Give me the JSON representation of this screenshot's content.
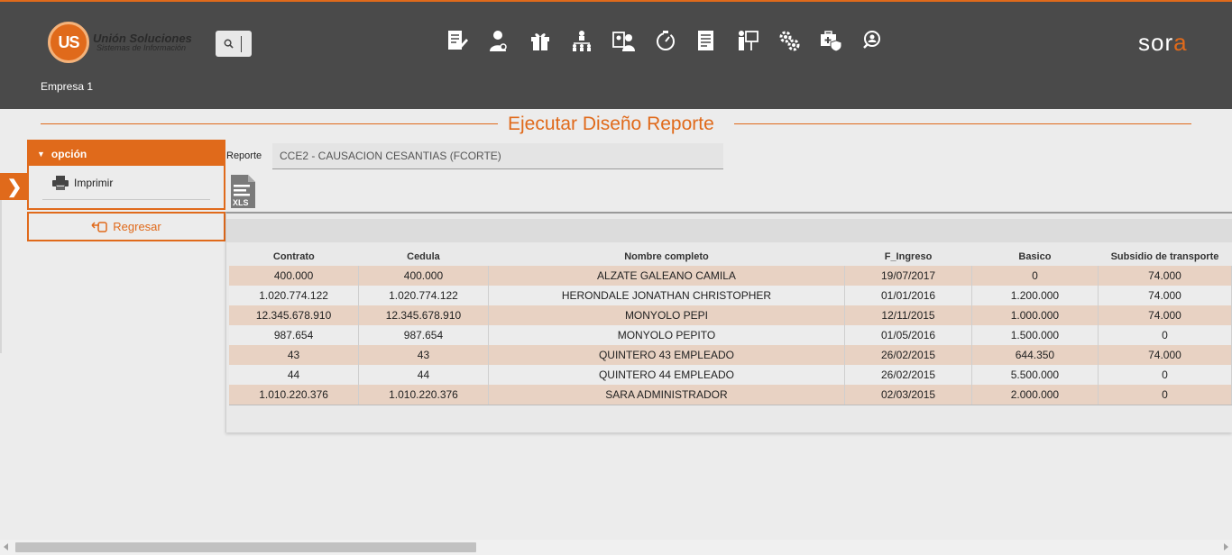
{
  "header": {
    "logo_main": "Unión Soluciones",
    "logo_sub": "Sistemas de Información",
    "logo_mark": "US",
    "company": "Empresa 1",
    "brand": {
      "s": "s",
      "o": "o",
      "r": "r",
      "a": "a"
    },
    "nav_icons": [
      "document-edit-icon",
      "employee-icon",
      "gift-icon",
      "org-chart-icon",
      "id-card-user-icon",
      "timer-icon",
      "report-list-icon",
      "presentation-icon",
      "settings-gears-icon",
      "medical-case-shield-icon",
      "user-search-icon"
    ]
  },
  "page": {
    "title": "Ejecutar Diseño Reporte"
  },
  "sidebar": {
    "panel_title": "opción",
    "items": [
      {
        "label": "Imprimir",
        "icon": "printer-icon"
      }
    ],
    "back_label": "Regresar"
  },
  "form": {
    "reporte_label": "Reporte",
    "reporte_value": "CCE2 - CAUSACION CESANTIAS (FCORTE)",
    "export_label": "XLS"
  },
  "table": {
    "columns": [
      "Contrato",
      "Cedula",
      "Nombre completo",
      "F_Ingreso",
      "Basico",
      "Subsidio de transporte"
    ],
    "rows": [
      [
        "400.000",
        "400.000",
        "ALZATE GALEANO CAMILA",
        "19/07/2017",
        "0",
        "74.000"
      ],
      [
        "1.020.774.122",
        "1.020.774.122",
        "HERONDALE JONATHAN CHRISTOPHER",
        "01/01/2016",
        "1.200.000",
        "74.000"
      ],
      [
        "12.345.678.910",
        "12.345.678.910",
        "MONYOLO PEPI",
        "12/11/2015",
        "1.000.000",
        "74.000"
      ],
      [
        "987.654",
        "987.654",
        "MONYOLO PEPITO",
        "01/05/2016",
        "1.500.000",
        "0"
      ],
      [
        "43",
        "43",
        "QUINTERO 43 EMPLEADO",
        "26/02/2015",
        "644.350",
        "74.000"
      ],
      [
        "44",
        "44",
        "QUINTERO 44 EMPLEADO",
        "26/02/2015",
        "5.500.000",
        "0"
      ],
      [
        "1.010.220.376",
        "1.010.220.376",
        "SARA ADMINISTRADOR",
        "02/03/2015",
        "2.000.000",
        "0"
      ]
    ]
  },
  "colors": {
    "accent": "#e06a1b",
    "header_bg": "#4a4a4a",
    "row_highlight": "#e8d2c3"
  }
}
